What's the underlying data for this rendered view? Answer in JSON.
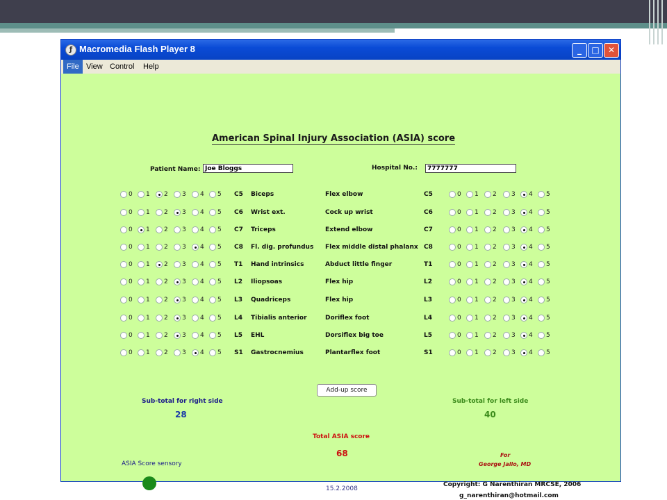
{
  "window": {
    "title": "Macromedia Flash Player 8"
  },
  "menu": [
    "File",
    "View",
    "Control",
    "Help"
  ],
  "heading": "American Spinal Injury Association (ASIA) score",
  "patient": {
    "name_label": "Patient Name:",
    "name_value": "Joe Bloggs",
    "hospital_label": "Hospital No.:",
    "hospital_value": "7777777"
  },
  "grades": [
    "0",
    "1",
    "2",
    "3",
    "4",
    "5"
  ],
  "rows": [
    {
      "level_right": "C5",
      "muscle": "Biceps",
      "action": "Flex elbow",
      "level_left": "C5",
      "right_score": 2,
      "left_score": 4
    },
    {
      "level_right": "C6",
      "muscle": "Wrist ext.",
      "action": "Cock up wrist",
      "level_left": "C6",
      "right_score": 3,
      "left_score": 4
    },
    {
      "level_right": "C7",
      "muscle": "Triceps",
      "action": "Extend elbow",
      "level_left": "C7",
      "right_score": 1,
      "left_score": 4
    },
    {
      "level_right": "C8",
      "muscle": "Fl. dig. profundus",
      "action": "Flex middle distal phalanx",
      "level_left": "C8",
      "right_score": 4,
      "left_score": 4
    },
    {
      "level_right": "T1",
      "muscle": "Hand intrinsics",
      "action": "Abduct little finger",
      "level_left": "T1",
      "right_score": 2,
      "left_score": 4
    },
    {
      "level_right": "L2",
      "muscle": "Iliopsoas",
      "action": "Flex hip",
      "level_left": "L2",
      "right_score": 3,
      "left_score": 4
    },
    {
      "level_right": "L3",
      "muscle": "Quadriceps",
      "action": "Flex hip",
      "level_left": "L3",
      "right_score": 3,
      "left_score": 4
    },
    {
      "level_right": "L4",
      "muscle": "Tibialis anterior",
      "action": "Doriflex foot",
      "level_left": "L4",
      "right_score": 3,
      "left_score": 4
    },
    {
      "level_right": "L5",
      "muscle": "EHL",
      "action": "Dorsiflex big toe",
      "level_left": "L5",
      "right_score": 3,
      "left_score": 4
    },
    {
      "level_right": "S1",
      "muscle": "Gastrocnemius",
      "action": "Plantarflex foot",
      "level_left": "S1",
      "right_score": 4,
      "left_score": 4
    }
  ],
  "add_button": "Add-up score",
  "subtotal_right": {
    "label": "Sub-total for right side",
    "value": "28"
  },
  "subtotal_left": {
    "label": "Sub-total for left side",
    "value": "40"
  },
  "total": {
    "label": "Total ASIA score",
    "value": "68"
  },
  "sens_label": "ASIA Score sensory",
  "date": "15.2.2008",
  "for_text": "For",
  "for_name": "George Jallo, MD",
  "copyright": "Copyright: G Narenthiran MRCSE, 2006",
  "email": "g_narenthiran@hotmail.com",
  "colors": {
    "background": "#cdfe9b",
    "titlebar": "#0a4bd6",
    "indicator": "#1a8a1a"
  }
}
